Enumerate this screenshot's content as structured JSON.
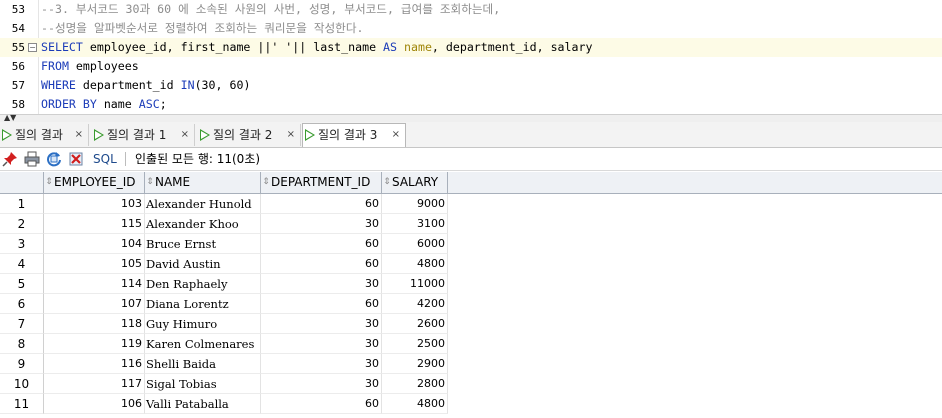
{
  "editor": {
    "lines": [
      {
        "num": "53",
        "parts": [
          {
            "t": "--3. 부서코드 30과 60 에 소속된 사원의 사번, 성명, 부서코드, 급여를 조회하는데,",
            "c": "cm"
          }
        ]
      },
      {
        "num": "54",
        "parts": [
          {
            "t": "--성명을 알파벳순서로 정렬하여 조회하는 쿼리문을 작성한다.",
            "c": "cm"
          }
        ]
      },
      {
        "num": "55",
        "fold": "⊟",
        "current": true,
        "parts": [
          {
            "t": "SELECT",
            "c": "kw"
          },
          {
            "t": " employee_id, first_name ||' '|| last_name ",
            "c": ""
          },
          {
            "t": "AS",
            "c": "kw"
          },
          {
            "t": " ",
            "c": ""
          },
          {
            "t": "name",
            "c": "cl"
          },
          {
            "t": ", department_id, salary",
            "c": ""
          }
        ]
      },
      {
        "num": "56",
        "parts": [
          {
            "t": "FROM",
            "c": "kw"
          },
          {
            "t": " employees",
            "c": ""
          }
        ]
      },
      {
        "num": "57",
        "parts": [
          {
            "t": "WHERE",
            "c": "kw"
          },
          {
            "t": " department_id ",
            "c": ""
          },
          {
            "t": "IN",
            "c": "kw"
          },
          {
            "t": "(30, 60)",
            "c": ""
          }
        ]
      },
      {
        "num": "58",
        "parts": [
          {
            "t": "ORDER BY",
            "c": "kw"
          },
          {
            "t": " name ",
            "c": ""
          },
          {
            "t": "ASC",
            "c": "kw"
          },
          {
            "t": ";",
            "c": ""
          }
        ]
      }
    ]
  },
  "tabs": [
    {
      "label": "질의 결과",
      "close": "×",
      "active": false
    },
    {
      "label": "질의 결과 1",
      "close": "×",
      "active": false
    },
    {
      "label": "질의 결과 2",
      "close": "×",
      "active": false
    },
    {
      "label": "질의 결과 3",
      "close": "×",
      "active": true
    }
  ],
  "toolbar": {
    "sql_label": "SQL",
    "status": "인출된 모든 행: 11(0초)",
    "icons": [
      "pin-icon",
      "print-icon",
      "refresh-icon",
      "delete-icon"
    ]
  },
  "grid": {
    "columns": [
      "EMPLOYEE_ID",
      "NAME",
      "DEPARTMENT_ID",
      "SALARY"
    ],
    "rows": [
      {
        "rn": "1",
        "id": "103",
        "name": "Alexander Hunold",
        "dept": "60",
        "salary": "9000"
      },
      {
        "rn": "2",
        "id": "115",
        "name": "Alexander Khoo",
        "dept": "30",
        "salary": "3100"
      },
      {
        "rn": "3",
        "id": "104",
        "name": "Bruce Ernst",
        "dept": "60",
        "salary": "6000"
      },
      {
        "rn": "4",
        "id": "105",
        "name": "David Austin",
        "dept": "60",
        "salary": "4800"
      },
      {
        "rn": "5",
        "id": "114",
        "name": "Den Raphaely",
        "dept": "30",
        "salary": "11000"
      },
      {
        "rn": "6",
        "id": "107",
        "name": "Diana Lorentz",
        "dept": "60",
        "salary": "4200"
      },
      {
        "rn": "7",
        "id": "118",
        "name": "Guy Himuro",
        "dept": "30",
        "salary": "2600"
      },
      {
        "rn": "8",
        "id": "119",
        "name": "Karen Colmenares",
        "dept": "30",
        "salary": "2500"
      },
      {
        "rn": "9",
        "id": "116",
        "name": "Shelli Baida",
        "dept": "30",
        "salary": "2900"
      },
      {
        "rn": "10",
        "id": "117",
        "name": "Sigal Tobias",
        "dept": "30",
        "salary": "2800"
      },
      {
        "rn": "11",
        "id": "106",
        "name": "Valli Pataballa",
        "dept": "60",
        "salary": "4800"
      }
    ]
  }
}
